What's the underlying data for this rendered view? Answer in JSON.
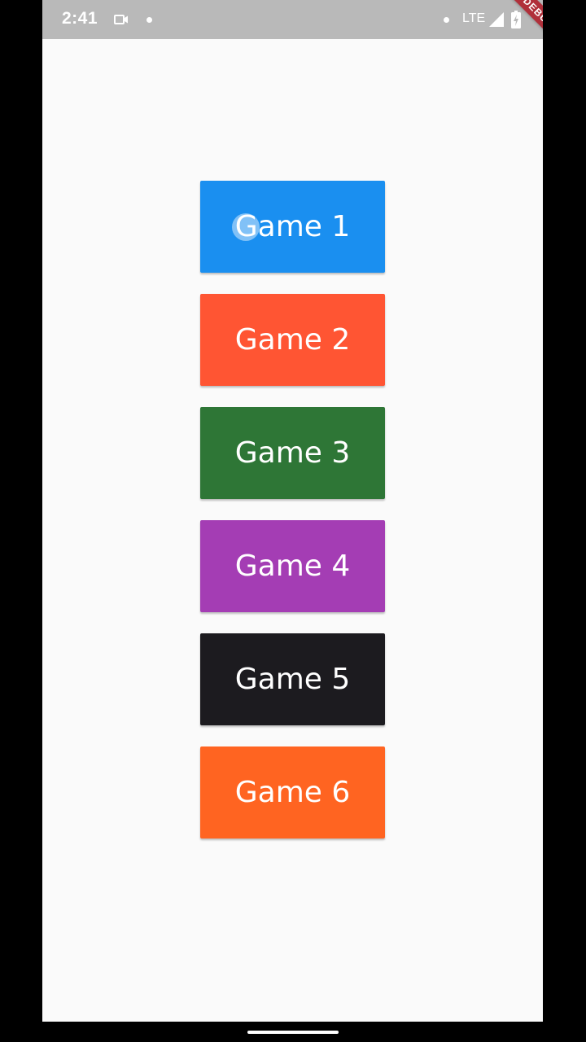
{
  "status_bar": {
    "time": "2:41",
    "network": "LTE",
    "icons": [
      "video-camera-icon",
      "dot-icon",
      "signal-icon",
      "battery-icon"
    ]
  },
  "debug_banner": {
    "label": "DEBUG",
    "color": "#b0303a"
  },
  "games": [
    {
      "label": "Game 1",
      "color": "#1a8ff0"
    },
    {
      "label": "Game 2",
      "color": "#ff5533"
    },
    {
      "label": "Game 3",
      "color": "#2e7636"
    },
    {
      "label": "Game 4",
      "color": "#a43db4"
    },
    {
      "label": "Game 5",
      "color": "#1c1b1f"
    },
    {
      "label": "Game 6",
      "color": "#ff6421"
    }
  ]
}
